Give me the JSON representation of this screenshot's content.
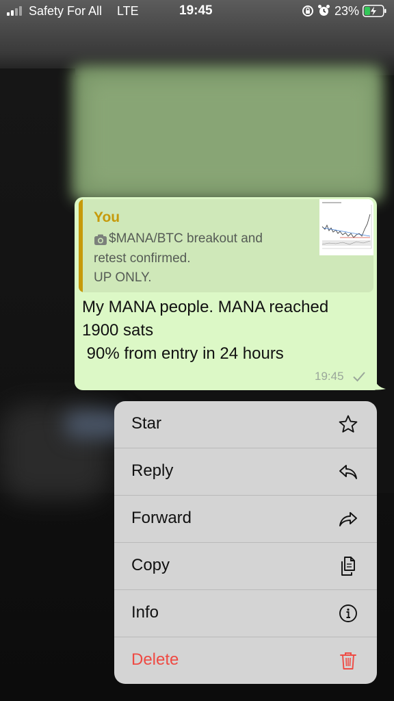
{
  "status_bar": {
    "carrier": "Safety For All",
    "network": "LTE",
    "time": "19:45",
    "battery": "23%"
  },
  "message": {
    "quote": {
      "author": "You",
      "lines": [
        "$MANA/BTC breakout and",
        "retest confirmed.",
        "UP ONLY."
      ]
    },
    "lines": [
      "My MANA people. MANA reached",
      "1900 sats",
      " 90% from entry in 24 hours"
    ],
    "time": "19:45"
  },
  "context_menu": {
    "items": [
      {
        "label": "Star",
        "icon": "star-icon"
      },
      {
        "label": "Reply",
        "icon": "reply-icon"
      },
      {
        "label": "Forward",
        "icon": "forward-icon"
      },
      {
        "label": "Copy",
        "icon": "copy-icon"
      },
      {
        "label": "Info",
        "icon": "info-icon"
      },
      {
        "label": "Delete",
        "icon": "trash-icon"
      }
    ]
  },
  "colors": {
    "bubble": "#dcf8c6",
    "quote_accent": "#c69a0b",
    "menu_bg": "#d4d4d4",
    "danger": "#ef4a43"
  }
}
